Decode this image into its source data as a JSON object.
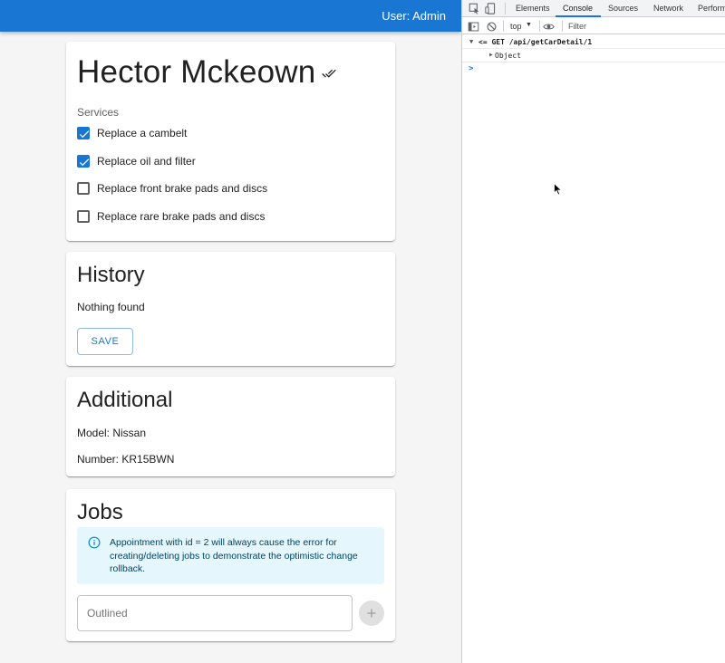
{
  "app": {
    "user_label": "User: Admin",
    "customer": {
      "name": "Hector Mckeown",
      "services_label": "Services",
      "services": [
        {
          "label": "Replace a cambelt",
          "checked": true
        },
        {
          "label": "Replace oil and filter",
          "checked": true
        },
        {
          "label": "Replace front brake pads and discs",
          "checked": false
        },
        {
          "label": "Replace rare brake pads and discs",
          "checked": false
        }
      ]
    },
    "history": {
      "title": "History",
      "empty_text": "Nothing found",
      "save_label": "SAVE"
    },
    "additional": {
      "title": "Additional",
      "model": "Model: Nissan",
      "number": "Number: KR15BWN"
    },
    "jobs": {
      "title": "Jobs",
      "alert": "Appointment with id = 2 will always cause the error for creating/deleting jobs to demonstrate the optimistic change rollback.",
      "input_placeholder": "Outlined",
      "input_value": "",
      "add_icon": "plus-icon"
    },
    "colors": {
      "primary": "#1976d2",
      "alert_bg": "#e5f6fd",
      "alert_text": "#014361"
    }
  },
  "devtools": {
    "tabs": [
      "Elements",
      "Console",
      "Sources",
      "Network",
      "Perform"
    ],
    "active_tab": "Console",
    "context": "top",
    "filter_placeholder": "Filter",
    "logs": [
      {
        "text": "<= GET /api/getCarDetail/1",
        "expanded": true
      },
      {
        "text": "Object",
        "expanded": false
      }
    ],
    "prompt": ">"
  }
}
